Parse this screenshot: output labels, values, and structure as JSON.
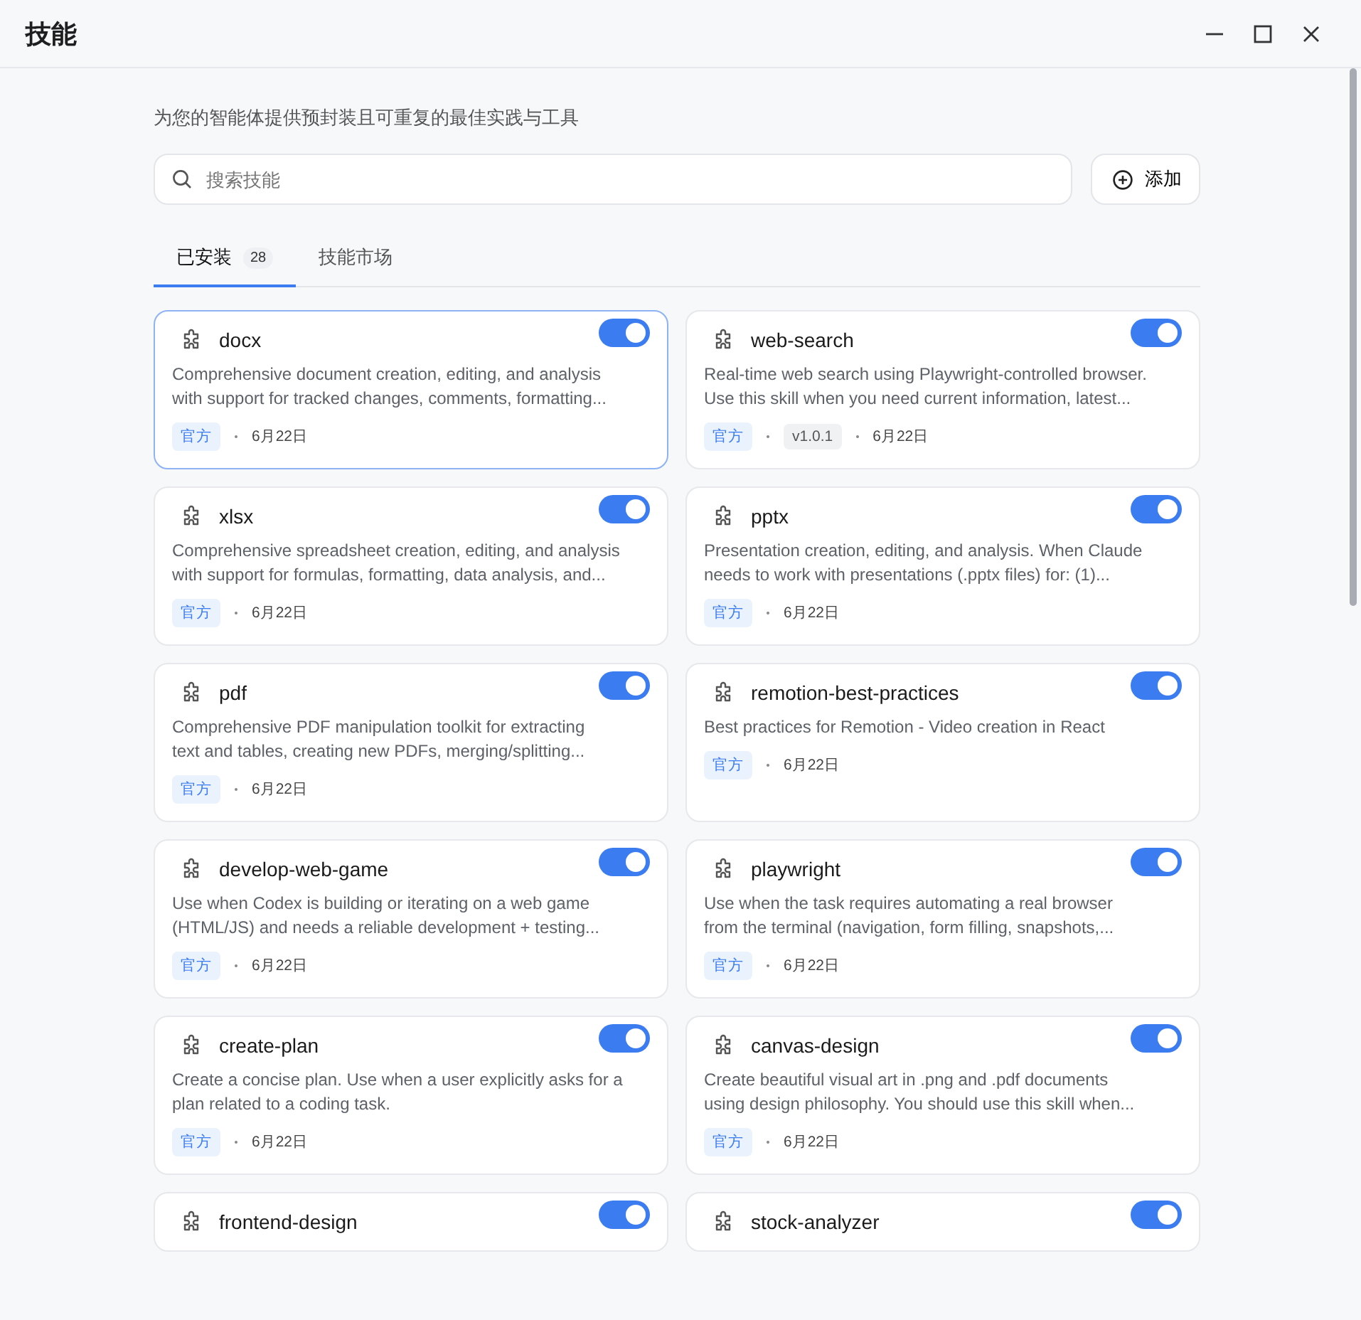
{
  "window": {
    "title": "技能"
  },
  "subtitle": "为您的智能体提供预封装且可重复的最佳实践与工具",
  "search": {
    "placeholder": "搜索技能"
  },
  "add_button": {
    "label": "添加"
  },
  "tabs": [
    {
      "label": "已安装",
      "count": "28",
      "selected": true
    },
    {
      "label": "技能市场",
      "selected": false
    }
  ],
  "skills": [
    {
      "name": "docx",
      "enabled": true,
      "selected": true,
      "description": "Comprehensive document creation, editing, and analysis\nwith support for tracked changes, comments, formatting...",
      "tag": "官方",
      "date": "6月22日"
    },
    {
      "name": "web-search",
      "enabled": true,
      "selected": false,
      "description": "Real-time web search using Playwright-controlled browser.\nUse this skill when you need current information, latest...",
      "tag": "官方",
      "version": "v1.0.1",
      "date": "6月22日"
    },
    {
      "name": "xlsx",
      "enabled": true,
      "selected": false,
      "description": "Comprehensive spreadsheet creation, editing, and analysis\nwith support for formulas, formatting, data analysis, and...",
      "tag": "官方",
      "date": "6月22日"
    },
    {
      "name": "pptx",
      "enabled": true,
      "selected": false,
      "description": "Presentation creation, editing, and analysis. When Claude\nneeds to work with presentations (.pptx files) for: (1)...",
      "tag": "官方",
      "date": "6月22日"
    },
    {
      "name": "pdf",
      "enabled": true,
      "selected": false,
      "description": "Comprehensive PDF manipulation toolkit for extracting\ntext and tables, creating new PDFs, merging/splitting...",
      "tag": "官方",
      "date": "6月22日"
    },
    {
      "name": "remotion-best-practices",
      "enabled": true,
      "selected": false,
      "description": "Best practices for Remotion - Video creation in React",
      "tag": "官方",
      "date": "6月22日"
    },
    {
      "name": "develop-web-game",
      "enabled": true,
      "selected": false,
      "description": "Use when Codex is building or iterating on a web game\n(HTML/JS) and needs a reliable development + testing...",
      "tag": "官方",
      "date": "6月22日"
    },
    {
      "name": "playwright",
      "enabled": true,
      "selected": false,
      "description": "Use when the task requires automating a real browser\nfrom the terminal (navigation, form filling, snapshots,...",
      "tag": "官方",
      "date": "6月22日"
    },
    {
      "name": "create-plan",
      "enabled": true,
      "selected": false,
      "description": "Create a concise plan. Use when a user explicitly asks for a\nplan related to a coding task.",
      "tag": "官方",
      "date": "6月22日"
    },
    {
      "name": "canvas-design",
      "enabled": true,
      "selected": false,
      "description": "Create beautiful visual art in .png and .pdf documents\nusing design philosophy. You should use this skill when...",
      "tag": "官方",
      "date": "6月22日"
    },
    {
      "name": "frontend-design",
      "enabled": true,
      "selected": false
    },
    {
      "name": "stock-analyzer",
      "enabled": true,
      "selected": false
    }
  ]
}
